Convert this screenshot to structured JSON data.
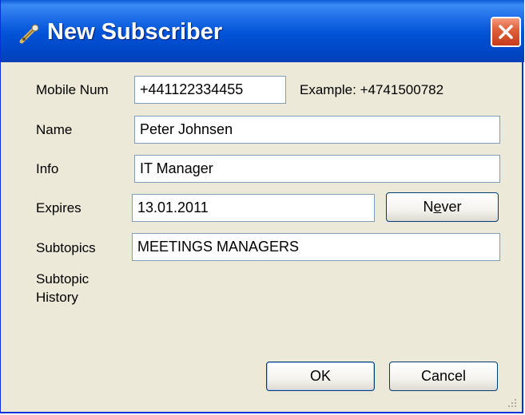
{
  "window": {
    "title": "New Subscriber",
    "icon": "satellite-dish-icon",
    "close_icon": "close-icon"
  },
  "form": {
    "mobile_label": "Mobile Num",
    "mobile_value": "+441122334455",
    "mobile_example": "Example: +4741500782",
    "name_label": "Name",
    "name_value": "Peter Johnsen",
    "info_label": "Info",
    "info_value": "IT Manager",
    "expires_label": "Expires",
    "expires_value": "13.01.2011",
    "never_label_prefix": "N",
    "never_label_accel": "e",
    "never_label_suffix": "ver",
    "subtopics_label": "Subtopics",
    "subtopics_value": "MEETINGS MANAGERS",
    "subtopic_history_label_line1": "Subtopic",
    "subtopic_history_label_line2": "History"
  },
  "buttons": {
    "ok_label": "OK",
    "cancel_label": "Cancel"
  },
  "colors": {
    "titlebar": "#0052d6",
    "dialog_bg": "#ece9d8",
    "close_button": "#e0613c",
    "textbox_border": "#7f9db9"
  }
}
